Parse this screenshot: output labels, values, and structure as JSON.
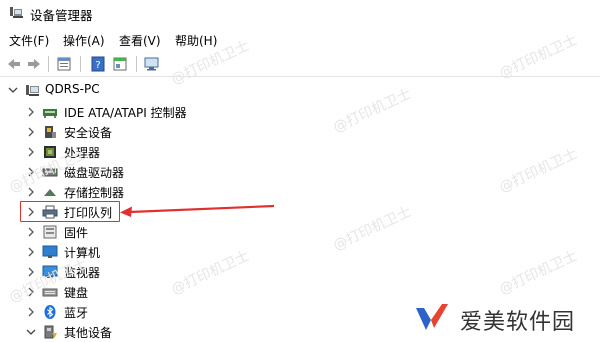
{
  "window": {
    "title": "设备管理器"
  },
  "menu": {
    "items": [
      "文件(F)",
      "操作(A)",
      "查看(V)",
      "帮助(H)"
    ]
  },
  "tree": {
    "root": "QDRS-PC",
    "categories": [
      "IDE ATA/ATAPI 控制器",
      "安全设备",
      "处理器",
      "磁盘驱动器",
      "存储控制器",
      "打印队列",
      "固件",
      "计算机",
      "监视器",
      "键盘",
      "蓝牙",
      "其他设备"
    ]
  },
  "watermark": {
    "text": "@打印机卫士"
  },
  "brand": {
    "name": "爱美软件园"
  },
  "colors": {
    "annotation": "#e03030",
    "brand_blue": "#2b63c9",
    "brand_red": "#e8432f"
  }
}
